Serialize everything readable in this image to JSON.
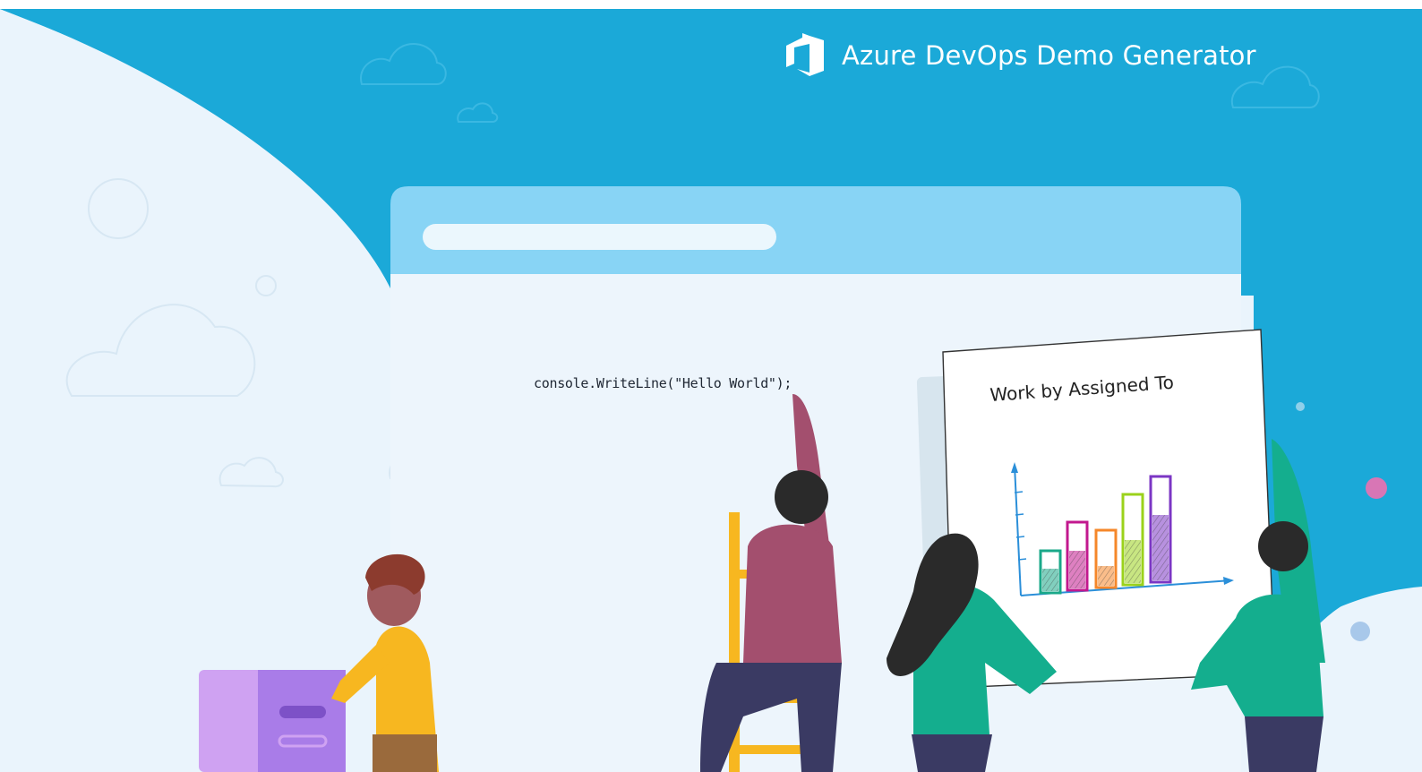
{
  "header": {
    "title": "Azure DevOps Demo Generator",
    "logo_icon": "azure-devops-logo-icon"
  },
  "illustration": {
    "code_snippet": "console.WriteLine(\"Hello World\");",
    "board_title": "Work by Assigned To",
    "board_bar_colors": [
      "#1aa889",
      "#c2188e",
      "#f5872a",
      "#9bd21b",
      "#7b36c4"
    ]
  },
  "colors": {
    "header_blue": "#1ba9d8",
    "page_background": "#eaf4fc",
    "browser_bar": "#88d4f5",
    "accent_pink": "#d876b5"
  }
}
